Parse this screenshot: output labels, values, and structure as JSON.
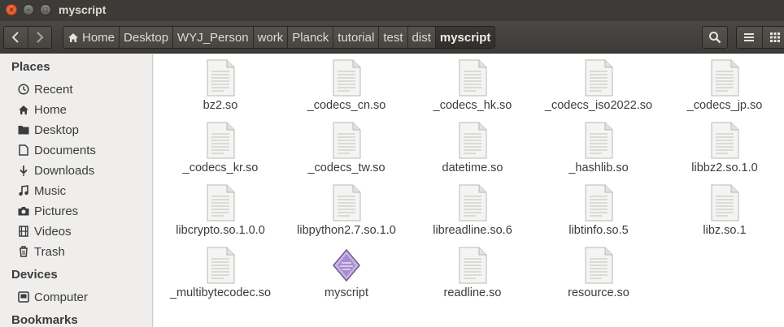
{
  "window": {
    "title": "myscript"
  },
  "breadcrumbs": [
    "Home",
    "Desktop",
    "WYJ_Person",
    "work",
    "Planck",
    "tutorial",
    "test",
    "dist",
    "myscript"
  ],
  "sidebar": {
    "places_heading": "Places",
    "places": [
      {
        "label": "Recent",
        "icon": "clock-icon"
      },
      {
        "label": "Home",
        "icon": "home-icon"
      },
      {
        "label": "Desktop",
        "icon": "folder-icon"
      },
      {
        "label": "Documents",
        "icon": "document-icon"
      },
      {
        "label": "Downloads",
        "icon": "download-icon"
      },
      {
        "label": "Music",
        "icon": "music-icon"
      },
      {
        "label": "Pictures",
        "icon": "camera-icon"
      },
      {
        "label": "Videos",
        "icon": "film-icon"
      },
      {
        "label": "Trash",
        "icon": "trash-icon"
      }
    ],
    "devices_heading": "Devices",
    "devices": [
      {
        "label": "Computer",
        "icon": "computer-icon"
      }
    ],
    "bookmarks_heading": "Bookmarks"
  },
  "files": [
    {
      "name": "bz2.so",
      "icon": "shared-library-icon"
    },
    {
      "name": "_codecs_cn.so",
      "icon": "shared-library-icon"
    },
    {
      "name": "_codecs_hk.so",
      "icon": "shared-library-icon"
    },
    {
      "name": "_codecs_iso2022.so",
      "icon": "shared-library-icon"
    },
    {
      "name": "_codecs_jp.so",
      "icon": "shared-library-icon"
    },
    {
      "name": "_codecs_kr.so",
      "icon": "shared-library-icon"
    },
    {
      "name": "_codecs_tw.so",
      "icon": "shared-library-icon"
    },
    {
      "name": "datetime.so",
      "icon": "shared-library-icon"
    },
    {
      "name": "_hashlib.so",
      "icon": "shared-library-icon"
    },
    {
      "name": "libbz2.so.1.0",
      "icon": "shared-library-icon"
    },
    {
      "name": "libcrypto.so.1.0.0",
      "icon": "shared-library-icon"
    },
    {
      "name": "libpython2.7.so.1.0",
      "icon": "shared-library-icon"
    },
    {
      "name": "libreadline.so.6",
      "icon": "shared-library-icon"
    },
    {
      "name": "libtinfo.so.5",
      "icon": "shared-library-icon"
    },
    {
      "name": "libz.so.1",
      "icon": "shared-library-icon"
    },
    {
      "name": "_multibytecodec.so",
      "icon": "shared-library-icon"
    },
    {
      "name": "myscript",
      "icon": "executable-icon"
    },
    {
      "name": "readline.so",
      "icon": "shared-library-icon"
    },
    {
      "name": "resource.so",
      "icon": "shared-library-icon"
    }
  ],
  "colors": {
    "titlebar": "#3c3b37",
    "close_button": "#df4a16",
    "sidebar_bg": "#efeeed",
    "content_bg": "#ffffff"
  }
}
